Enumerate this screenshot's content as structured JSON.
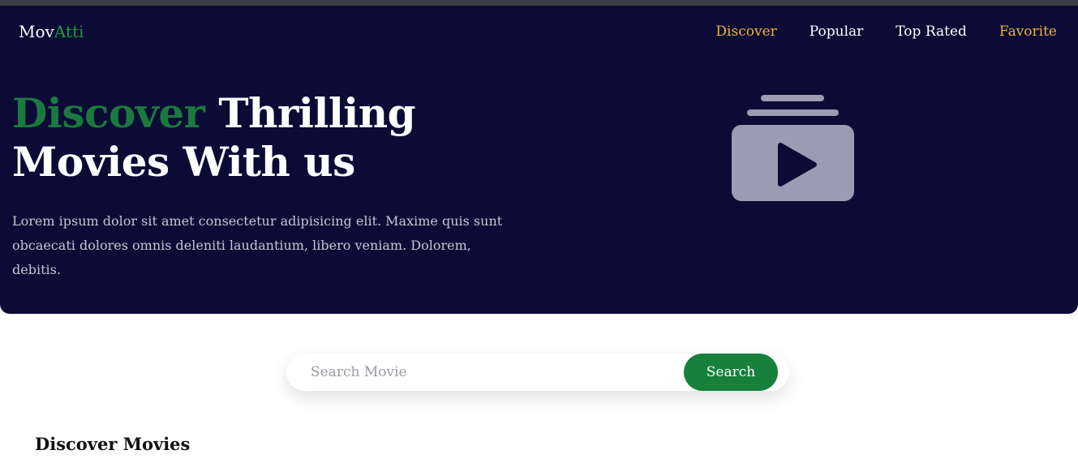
{
  "brand": {
    "name_part1": "Mov",
    "name_part2": "Atti",
    "accent_color": "#1a9a45"
  },
  "nav": {
    "items": [
      {
        "label": "Discover",
        "highlighted": true
      },
      {
        "label": "Popular",
        "highlighted": false
      },
      {
        "label": "Top Rated",
        "highlighted": false
      },
      {
        "label": "Favorite",
        "highlighted": true
      }
    ],
    "highlight_color": "#f2b233"
  },
  "hero": {
    "headline_accent": "Discover",
    "headline_rest_line1": " Thrilling",
    "headline_line2": "Movies With us",
    "description": "Lorem ipsum dolor sit amet consectetur adipisicing elit. Maxime quis sunt obcaecati dolores omnis deleniti laudantium, libero veniam. Dolorem, debitis.",
    "icon": "video-library-icon",
    "background_color": "#0b0b36"
  },
  "search": {
    "placeholder": "Search Movie",
    "value": "",
    "button_label": "Search",
    "button_color": "#16803c"
  },
  "section": {
    "title": "Discover Movies"
  }
}
